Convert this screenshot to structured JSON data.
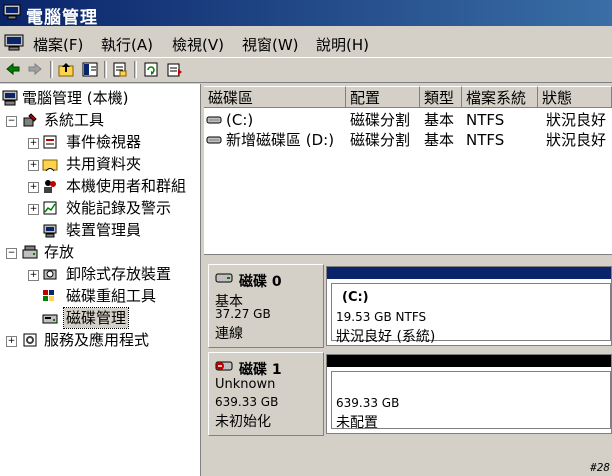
{
  "window": {
    "title": "電腦管理"
  },
  "menu": [
    "檔案(F)",
    "執行(A)",
    "檢視(V)",
    "視窗(W)",
    "說明(H)"
  ],
  "toolbar": {
    "buttons": [
      "back-icon",
      "forward-icon",
      "up-folder-icon",
      "show-tree-icon",
      "properties-icon",
      "refresh-icon",
      "export-list-icon"
    ]
  },
  "tree": {
    "root": "電腦管理 (本機)",
    "system_tools": "系統工具",
    "event_viewer": "事件檢視器",
    "shared_folders": "共用資料夾",
    "local_users": "本機使用者和群組",
    "perf_logs": "效能記錄及警示",
    "device_manager": "裝置管理員",
    "storage": "存放",
    "removable": "卸除式存放裝置",
    "defrag": "磁碟重組工具",
    "disk_mgmt": "磁碟管理",
    "services": "服務及應用程式"
  },
  "volume_list": {
    "columns": [
      "磁碟區",
      "配置",
      "類型",
      "檔案系統",
      "狀態"
    ],
    "rows": [
      [
        "(C:)",
        "磁碟分割",
        "基本",
        "NTFS",
        "狀況良好"
      ],
      [
        "新增磁碟區 (D:)",
        "磁碟分割",
        "基本",
        "NTFS",
        "狀況良好"
      ]
    ]
  },
  "disks": [
    {
      "name": "磁碟 0",
      "type": "基本",
      "size": "37.27 GB",
      "status": "連線",
      "partition": {
        "label": "(C:)",
        "info": "19.53 GB NTFS",
        "status": "狀況良好 (系統)"
      },
      "bar_color": "#0a246a"
    },
    {
      "name": "磁碟 1",
      "type": "Unknown",
      "size": "639.33 GB",
      "status": "未初始化",
      "partition": {
        "info": "639.33 GB",
        "status": "未配置"
      },
      "bar_color": "#000000"
    }
  ],
  "watermark": "#28"
}
